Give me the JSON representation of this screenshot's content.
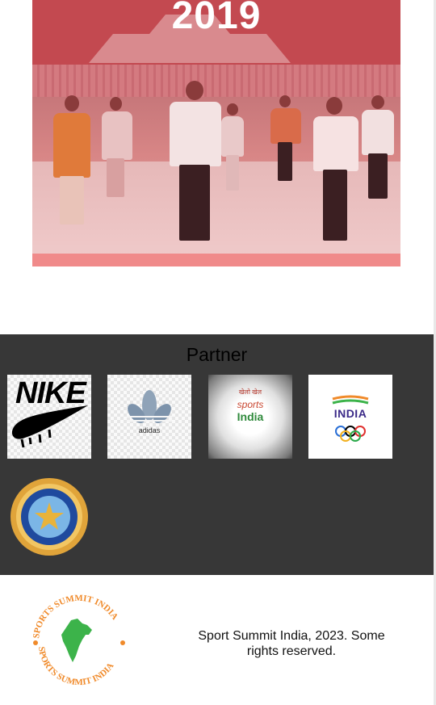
{
  "hero": {
    "year": "2019",
    "image": "yoga-event-stadium-photo"
  },
  "partners": {
    "title": "Partner",
    "logos": [
      {
        "name": "Nike",
        "icon": "nike-logo",
        "text": "NIKE"
      },
      {
        "name": "Adidas",
        "icon": "adidas-logo",
        "text": "adidas"
      },
      {
        "name": "Sports India",
        "icon": "sports-india-logo",
        "text_top": "खेलो खेल",
        "text_mid": "sports",
        "text_bottom": "India"
      },
      {
        "name": "Indian Olympic Association",
        "icon": "india-olympic-logo",
        "text": "INDIA"
      },
      {
        "name": "BCCI",
        "icon": "bcci-logo"
      }
    ]
  },
  "footer": {
    "logo_text": "SPORTS SUMMIT INDIA",
    "copyright": "Sport Summit India, 2023. Some rights reserved."
  },
  "colors": {
    "partner_bg": "#373737",
    "hero_overlay": "#d9565e",
    "footer_logo_orange": "#f08a2a",
    "footer_logo_green": "#3cb34a"
  }
}
